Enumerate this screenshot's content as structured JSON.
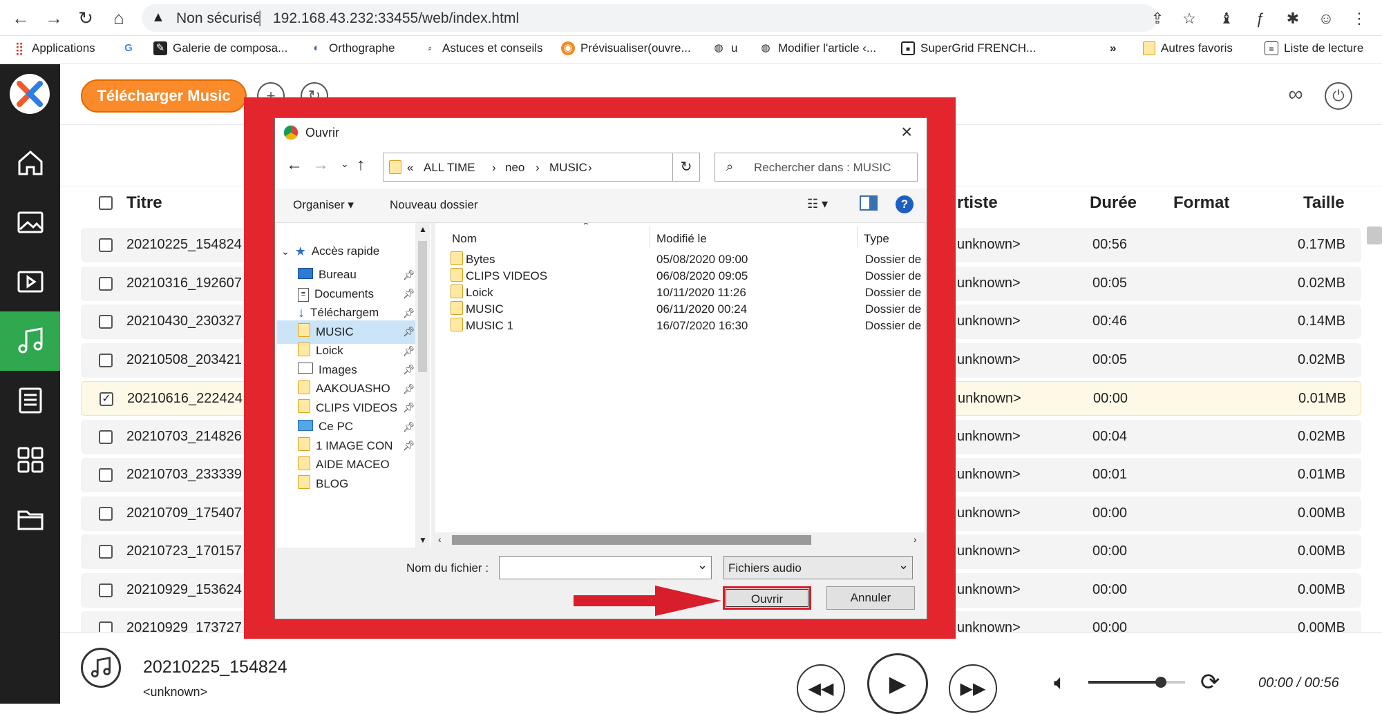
{
  "browser": {
    "security_label": "Non sécurisé",
    "separator": "|",
    "url": "192.168.43.232:33455/web/index.html",
    "bookmarks": [
      "Applications",
      "Galerie de composa...",
      "Orthographe",
      "Astuces et conseils",
      "Prévisualiser(ouvre...",
      "u",
      "Modifier l'article ‹...",
      "SuperGrid FRENCH...",
      "»",
      "Autres favoris",
      "Liste de lecture"
    ]
  },
  "app": {
    "download_button": "Télécharger Music",
    "table": {
      "headers": {
        "title": "Titre",
        "artist": "rtiste",
        "duration": "Durée",
        "format": "Format",
        "size": "Taille"
      },
      "rows": [
        {
          "title": "20210225_154824",
          "artist": "unknown>",
          "duration": "00:56",
          "size": "0.17MB",
          "checked": false
        },
        {
          "title": "20210316_192607",
          "artist": "unknown>",
          "duration": "00:05",
          "size": "0.02MB",
          "checked": false
        },
        {
          "title": "20210430_230327",
          "artist": "unknown>",
          "duration": "00:46",
          "size": "0.14MB",
          "checked": false
        },
        {
          "title": "20210508_203421",
          "artist": "unknown>",
          "duration": "00:05",
          "size": "0.02MB",
          "checked": false
        },
        {
          "title": "20210616_222424",
          "artist": "unknown>",
          "duration": "00:00",
          "size": "0.01MB",
          "checked": true
        },
        {
          "title": "20210703_214826",
          "artist": "unknown>",
          "duration": "00:04",
          "size": "0.02MB",
          "checked": false
        },
        {
          "title": "20210703_233339",
          "artist": "unknown>",
          "duration": "00:01",
          "size": "0.01MB",
          "checked": false
        },
        {
          "title": "20210709_175407",
          "artist": "unknown>",
          "duration": "00:00",
          "size": "0.00MB",
          "checked": false
        },
        {
          "title": "20210723_170157",
          "artist": "unknown>",
          "duration": "00:00",
          "size": "0.00MB",
          "checked": false
        },
        {
          "title": "20210929_153624",
          "artist": "unknown>",
          "duration": "00:00",
          "size": "0.00MB",
          "checked": false
        },
        {
          "title": "20210929_173727",
          "artist": "unknown>",
          "duration": "00:00",
          "size": "0.00MB",
          "checked": false
        }
      ]
    },
    "player": {
      "track_title": "20210225_154824",
      "track_artist": "<unknown>",
      "time": "00:00 / 00:56",
      "volume_fraction": 0.75
    }
  },
  "dialog": {
    "title": "Ouvrir",
    "path_prefix": "«",
    "path": [
      "ALL TIME",
      "neo",
      "MUSIC"
    ],
    "search_placeholder": "Rechercher dans : MUSIC",
    "organize": "Organiser",
    "new_folder": "Nouveau dossier",
    "columns": {
      "name": "Nom",
      "modified": "Modifié le",
      "type": "Type"
    },
    "quick_access": "Accès rapide",
    "tree": [
      {
        "label": "Bureau",
        "icon": "desktop-icon",
        "pinned": true
      },
      {
        "label": "Documents",
        "icon": "documents-icon",
        "pinned": true
      },
      {
        "label": "Téléchargem",
        "icon": "download-arrow-icon",
        "pinned": true
      },
      {
        "label": "MUSIC",
        "icon": "folder-icon",
        "pinned": true,
        "selected": true
      },
      {
        "label": "Loick",
        "icon": "folder-icon",
        "pinned": true
      },
      {
        "label": "Images",
        "icon": "images-icon",
        "pinned": true
      },
      {
        "label": "AAKOUASHO",
        "icon": "folder-icon",
        "pinned": true
      },
      {
        "label": "CLIPS VIDEOS",
        "icon": "folder-icon",
        "pinned": true
      },
      {
        "label": "Ce PC",
        "icon": "computer-icon",
        "pinned": true
      },
      {
        "label": "1 IMAGE CON",
        "icon": "folder-icon",
        "pinned": true
      },
      {
        "label": "AIDE MACEO",
        "icon": "folder-icon",
        "pinned": false
      },
      {
        "label": "BLOG",
        "icon": "folder-icon",
        "pinned": false
      }
    ],
    "files": [
      {
        "name": "Bytes",
        "modified": "05/08/2020 09:00",
        "type": "Dossier de fi"
      },
      {
        "name": "CLIPS VIDEOS",
        "modified": "06/08/2020 09:05",
        "type": "Dossier de fi"
      },
      {
        "name": "Loick",
        "modified": "10/11/2020 11:26",
        "type": "Dossier de fi"
      },
      {
        "name": "MUSIC",
        "modified": "06/11/2020 00:24",
        "type": "Dossier de fi"
      },
      {
        "name": "MUSIC 1",
        "modified": "16/07/2020 16:30",
        "type": "Dossier de fi"
      }
    ],
    "filename_label": "Nom du fichier :",
    "filename_value": "",
    "filter": "Fichiers audio",
    "open_button": "Ouvrir",
    "cancel_button": "Annuler"
  },
  "colors": {
    "accent_orange": "#fb8a2a",
    "sidebar_active": "#2fa84f",
    "highlight_red": "#e3262e"
  }
}
